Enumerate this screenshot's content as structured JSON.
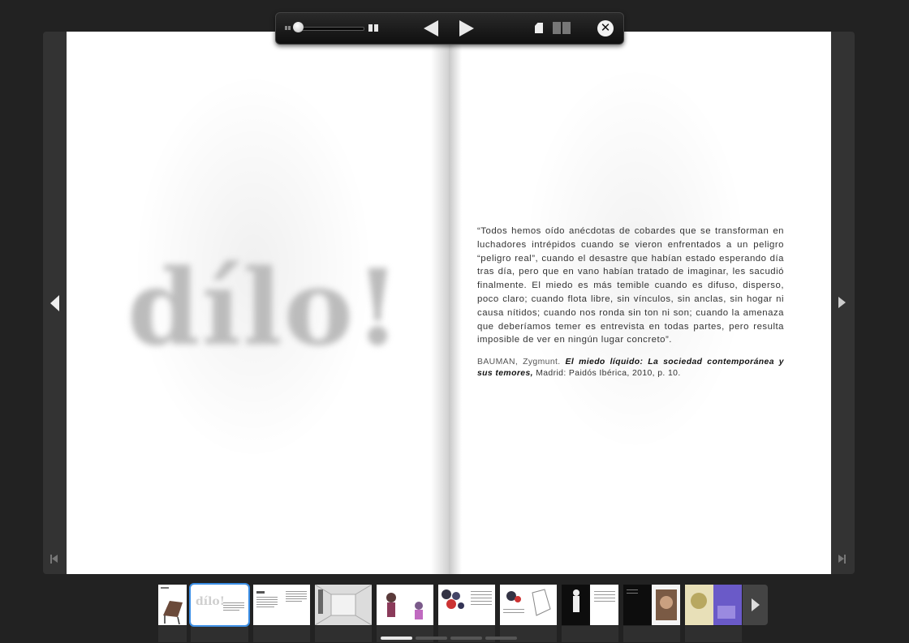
{
  "toolbar": {
    "zoom_level_fraction": 0.0,
    "buttons": [
      "zoom-out",
      "zoom-in",
      "previous",
      "next",
      "single-page",
      "double-page",
      "close"
    ],
    "close_glyph": "✕"
  },
  "spread": {
    "left_page": {
      "heading": "dílo!"
    },
    "right_page": {
      "quote": "“Todos hemos oído anécdotas de cobardes que se transforman en luchadores intrépidos cuando se vieron enfrentados a un peligro “peligro real”, cuando el desastre que habían estado esperando día tras día, pero que en vano habían tratado de imaginar, les sacudió finalmente. El miedo es más temible cuando es difuso, disperso, poco claro; cuando flota libre, sin vínculos, sin anclas, sin hogar ni causa nítidos; cuando nos ronda sin ton ni son; cuando la amenaza que deberíamos temer es entrevista en todas partes, pero resulta imposible de ver en ningún lugar concreto”.",
      "citation_author": "BAUMAN, Zygmunt.",
      "citation_title": "El miedo líquido: La sociedad contemporánea y sus temores,",
      "citation_publisher": "Madrid: Paidós Ibérica, 2010, p. 10."
    }
  },
  "thumbnails": {
    "selected_index": 1,
    "count_visible": 10,
    "thumbnail_heading": "dílo!",
    "page_indicator": {
      "pages": 4,
      "active": 0
    }
  },
  "colors": {
    "background": "#222222",
    "selection": "#3a8ee6",
    "page": "#ffffff"
  }
}
